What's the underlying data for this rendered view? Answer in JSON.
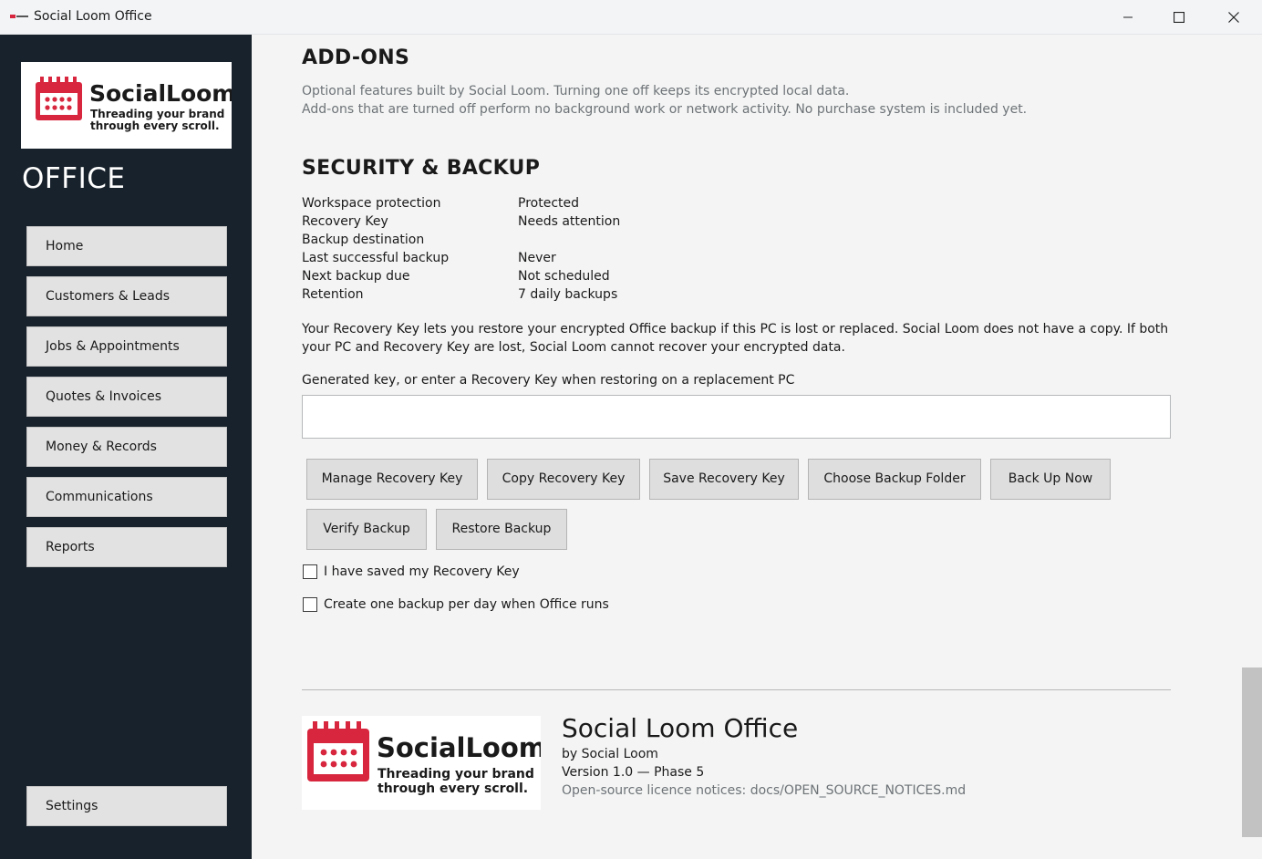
{
  "window": {
    "title": "Social Loom Office"
  },
  "sidebar": {
    "logo": {
      "brand": "SocialLoom",
      "tagline_1": "Threading your brand",
      "tagline_2": "through every scroll."
    },
    "office_title": "OFFICE",
    "nav": [
      {
        "label": "Home"
      },
      {
        "label": "Customers & Leads"
      },
      {
        "label": "Jobs & Appointments"
      },
      {
        "label": "Quotes & Invoices"
      },
      {
        "label": "Money & Records"
      },
      {
        "label": "Communications"
      },
      {
        "label": "Reports"
      }
    ],
    "settings_label": "Settings"
  },
  "addons": {
    "heading": "ADD-ONS",
    "line1": "Optional features built by Social Loom. Turning one off keeps its encrypted local data.",
    "line2": "Add-ons that are turned off perform no background work or network activity. No purchase system is included yet."
  },
  "security": {
    "heading": "SECURITY & BACKUP",
    "rows": [
      {
        "label": "Workspace protection",
        "value": "Protected"
      },
      {
        "label": "Recovery Key",
        "value": "Needs attention"
      },
      {
        "label": "Backup destination",
        "value": ""
      },
      {
        "label": "Last successful backup",
        "value": "Never"
      },
      {
        "label": "Next backup due",
        "value": "Not scheduled"
      },
      {
        "label": "Retention",
        "value": "7 daily backups"
      }
    ],
    "paragraph": "Your Recovery Key lets you restore your encrypted Office backup if this PC is lost or replaced. Social Loom does not have a copy. If both your PC and Recovery Key are lost, Social Loom cannot recover your encrypted data.",
    "key_field_label": "Generated key, or enter a Recovery Key when restoring on a replacement PC",
    "key_field_value": "",
    "buttons": {
      "manage": "Manage Recovery Key",
      "copy": "Copy Recovery Key",
      "save": "Save Recovery Key",
      "choose_folder": "Choose Backup Folder",
      "back_up_now": "Back Up Now",
      "verify": "Verify Backup",
      "restore": "Restore Backup"
    },
    "checkboxes": [
      {
        "label": "I have saved my Recovery Key",
        "checked": false
      },
      {
        "label": "Create one backup per day when Office runs",
        "checked": false
      }
    ]
  },
  "about": {
    "title": "Social Loom Office",
    "by": "by Social Loom",
    "version": "Version 1.0 — Phase 5",
    "licence": "Open-source licence notices: docs/OPEN_SOURCE_NOTICES.md"
  },
  "colors": {
    "sidebar_bg": "#18222c",
    "brand_red": "#d7263d",
    "content_bg": "#f3f4f3"
  }
}
